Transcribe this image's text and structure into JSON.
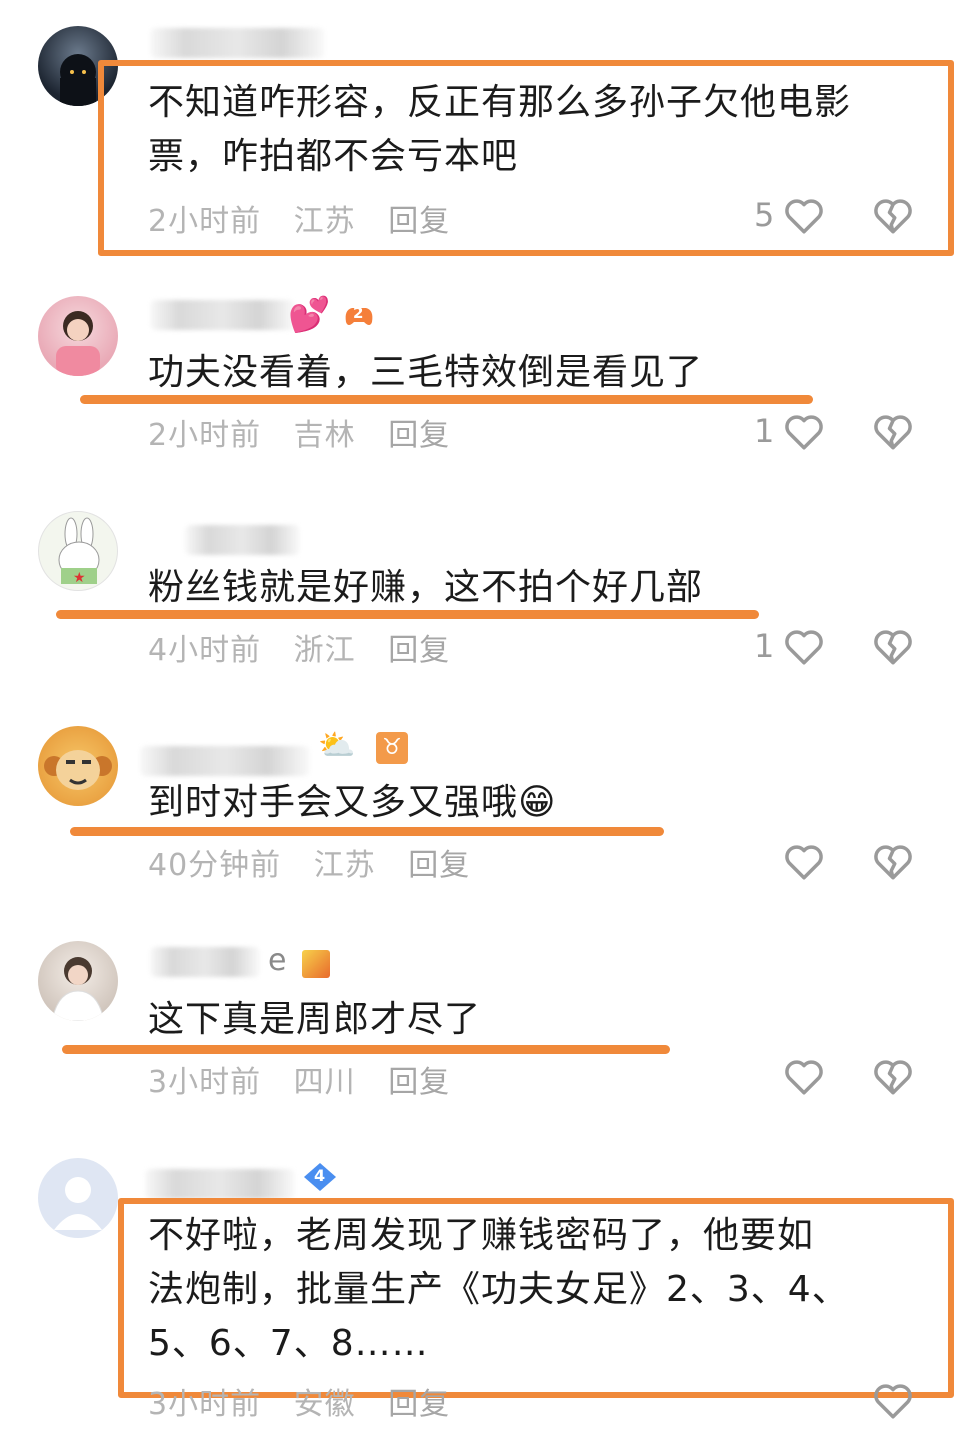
{
  "comments": [
    {
      "text_lines": [
        "不知道咋形容，反正有那么多孙子欠他电影",
        "票，咋拍都不会亏本吧"
      ],
      "time": "2小时前",
      "location": "江苏",
      "reply": "回复",
      "likes": "5"
    },
    {
      "text_lines": [
        "功夫没看着，三毛特效倒是看见了"
      ],
      "time": "2小时前",
      "location": "吉林",
      "reply": "回复",
      "likes": "1",
      "badge": "2"
    },
    {
      "text_lines": [
        "粉丝钱就是好赚，这不拍个好几部"
      ],
      "time": "4小时前",
      "location": "浙江",
      "reply": "回复",
      "likes": "1"
    },
    {
      "text_lines": [
        "到时对手会又多又强哦😁"
      ],
      "time": "40分钟前",
      "location": "江苏",
      "reply": "回复",
      "likes": "",
      "badge": "♉"
    },
    {
      "text_lines": [
        "这下真是周郎才尽了"
      ],
      "time": "3小时前",
      "location": "四川",
      "reply": "回复",
      "likes": "",
      "name_fragment": "e"
    },
    {
      "text_lines": [
        "不好啦，老周发现了赚钱密码了，他要如",
        "法炮制，批量生产《功夫女足》2、3、4、",
        "5、6、7、8……"
      ],
      "time": "3小时前",
      "location": "安徽",
      "reply": "回复",
      "likes": "",
      "badge": "4"
    }
  ],
  "colors": {
    "highlight": "#f0893a",
    "meta": "#b4b4b4",
    "text": "#1b1b1b"
  },
  "icons": [
    "heart-outline-icon",
    "broken-heart-icon"
  ]
}
